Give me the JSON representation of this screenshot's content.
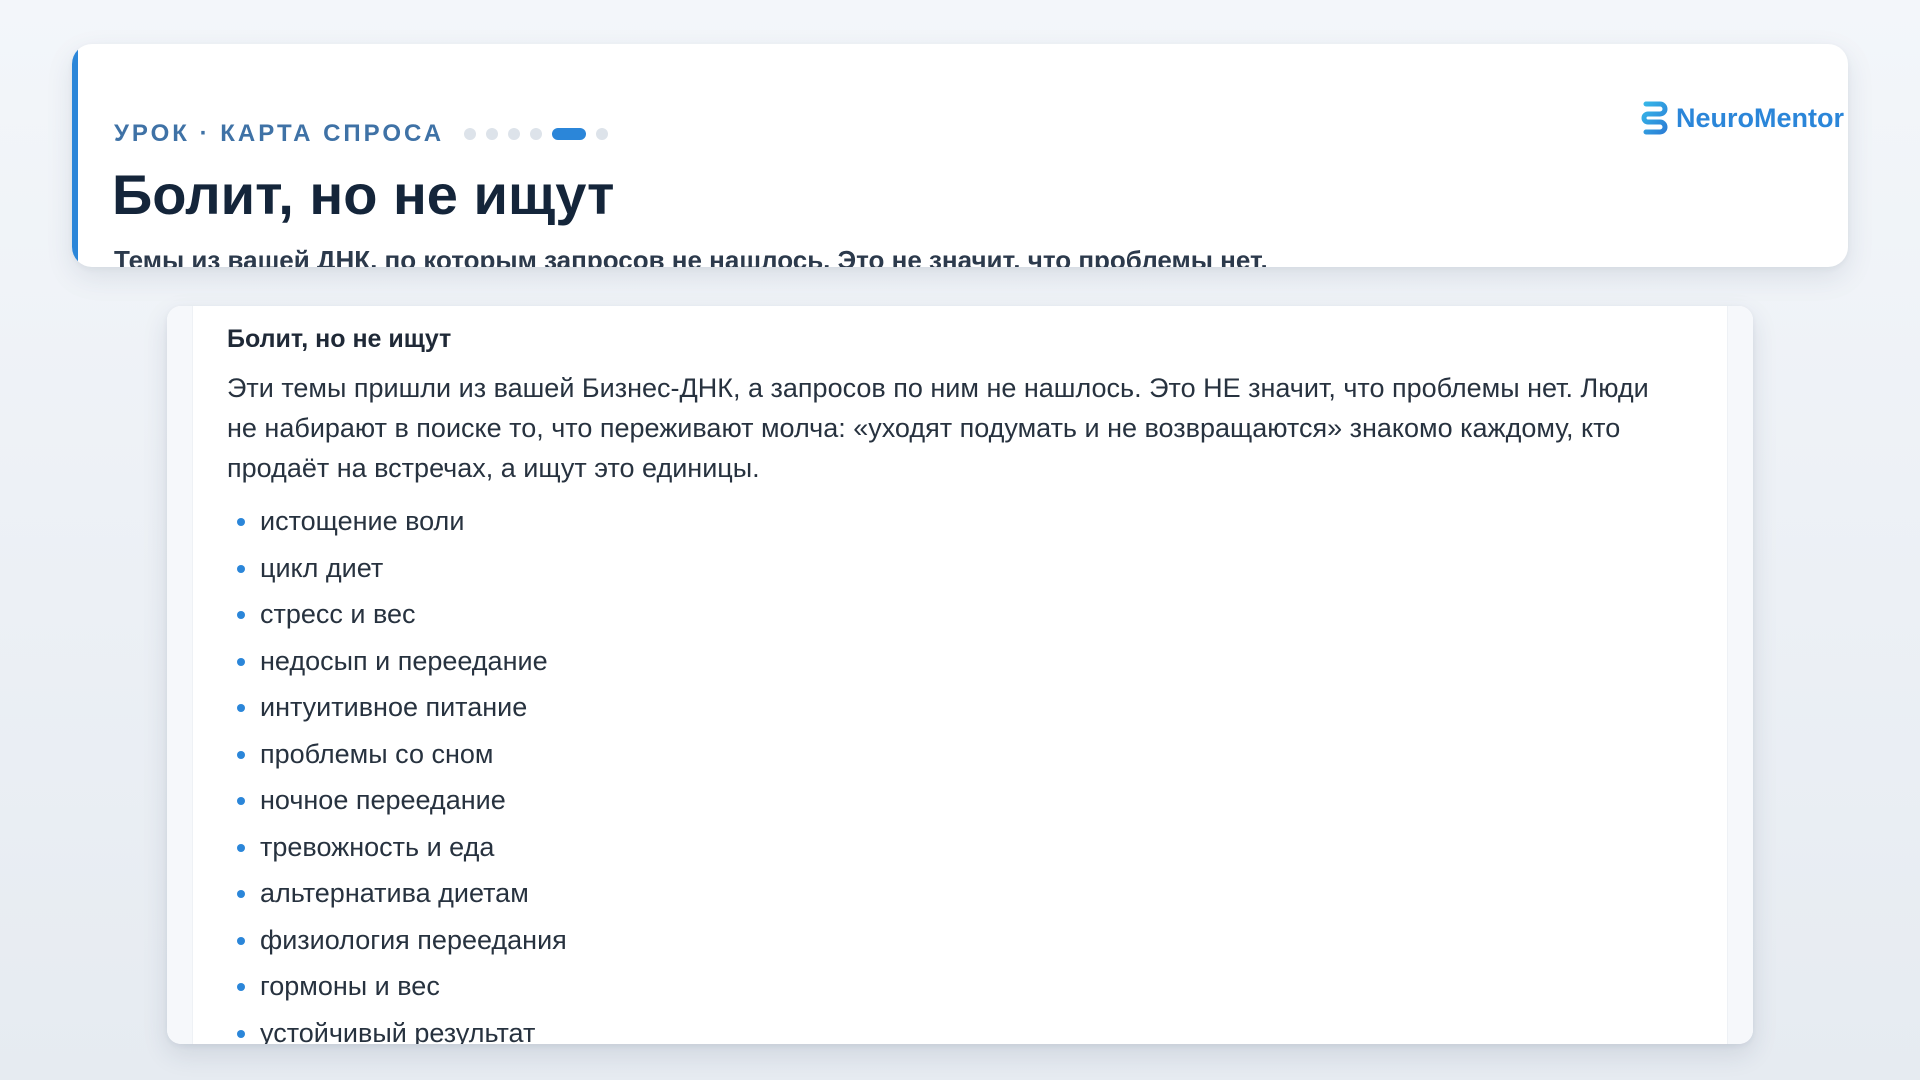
{
  "header": {
    "eyebrow": "УРОК · КАРТА СПРОСА",
    "progress": {
      "total_steps": 7,
      "current_step": 5
    },
    "title": "Болит, но не ищут",
    "subtitle": "Темы из вашей ДНК, по которым запросов не нашлось. Это не значит, что проблемы нет.",
    "accent_color": "#2b86d9"
  },
  "brand": {
    "name": "NeuroMentor",
    "logo_icon": "brain-logo-icon",
    "color": "#2b86d9"
  },
  "content": {
    "section_title": "Болит, но не ищут",
    "text": "Эти темы пришли из вашей Бизнес-ДНК, а запросов по ним не нашлось. Это НЕ значит, что проблемы нет. Люди не набирают в поиске то, что переживают молча: «уходят подумать и не возвращаются» знакомо каждому, кто продаёт на встречах, а ищут это единицы.",
    "topics": [
      "истощение воли",
      "цикл диет",
      "стресс и вес",
      "недосып и переедание",
      "интуитивное питание",
      "проблемы со сном",
      "ночное переедание",
      "тревожность и еда",
      "альтернатива диетам",
      "физиология переедания",
      "гормоны и вес",
      "устойчивый результат"
    ]
  }
}
